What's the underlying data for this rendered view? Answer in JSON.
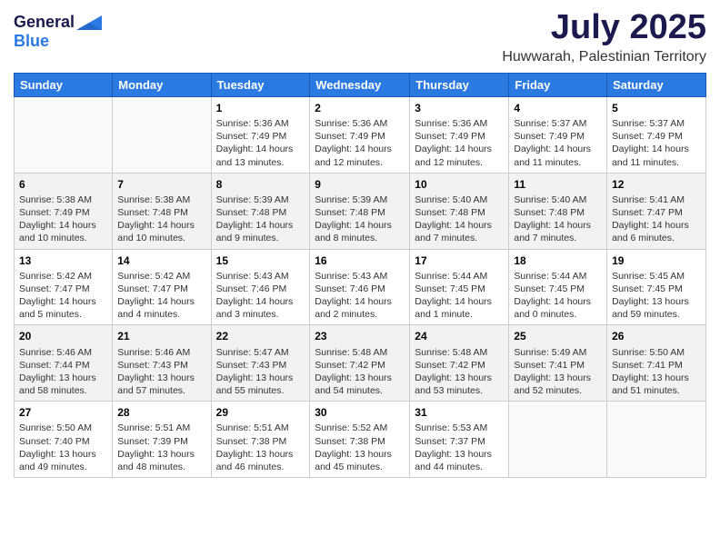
{
  "header": {
    "logo": {
      "general": "General",
      "blue": "Blue"
    },
    "title": "July 2025",
    "location": "Huwwarah, Palestinian Territory"
  },
  "weekdays": [
    "Sunday",
    "Monday",
    "Tuesday",
    "Wednesday",
    "Thursday",
    "Friday",
    "Saturday"
  ],
  "weeks": [
    [
      {
        "day": "",
        "info": ""
      },
      {
        "day": "",
        "info": ""
      },
      {
        "day": "1",
        "info": "Sunrise: 5:36 AM\nSunset: 7:49 PM\nDaylight: 14 hours\nand 13 minutes."
      },
      {
        "day": "2",
        "info": "Sunrise: 5:36 AM\nSunset: 7:49 PM\nDaylight: 14 hours\nand 12 minutes."
      },
      {
        "day": "3",
        "info": "Sunrise: 5:36 AM\nSunset: 7:49 PM\nDaylight: 14 hours\nand 12 minutes."
      },
      {
        "day": "4",
        "info": "Sunrise: 5:37 AM\nSunset: 7:49 PM\nDaylight: 14 hours\nand 11 minutes."
      },
      {
        "day": "5",
        "info": "Sunrise: 5:37 AM\nSunset: 7:49 PM\nDaylight: 14 hours\nand 11 minutes."
      }
    ],
    [
      {
        "day": "6",
        "info": "Sunrise: 5:38 AM\nSunset: 7:49 PM\nDaylight: 14 hours\nand 10 minutes."
      },
      {
        "day": "7",
        "info": "Sunrise: 5:38 AM\nSunset: 7:48 PM\nDaylight: 14 hours\nand 10 minutes."
      },
      {
        "day": "8",
        "info": "Sunrise: 5:39 AM\nSunset: 7:48 PM\nDaylight: 14 hours\nand 9 minutes."
      },
      {
        "day": "9",
        "info": "Sunrise: 5:39 AM\nSunset: 7:48 PM\nDaylight: 14 hours\nand 8 minutes."
      },
      {
        "day": "10",
        "info": "Sunrise: 5:40 AM\nSunset: 7:48 PM\nDaylight: 14 hours\nand 7 minutes."
      },
      {
        "day": "11",
        "info": "Sunrise: 5:40 AM\nSunset: 7:48 PM\nDaylight: 14 hours\nand 7 minutes."
      },
      {
        "day": "12",
        "info": "Sunrise: 5:41 AM\nSunset: 7:47 PM\nDaylight: 14 hours\nand 6 minutes."
      }
    ],
    [
      {
        "day": "13",
        "info": "Sunrise: 5:42 AM\nSunset: 7:47 PM\nDaylight: 14 hours\nand 5 minutes."
      },
      {
        "day": "14",
        "info": "Sunrise: 5:42 AM\nSunset: 7:47 PM\nDaylight: 14 hours\nand 4 minutes."
      },
      {
        "day": "15",
        "info": "Sunrise: 5:43 AM\nSunset: 7:46 PM\nDaylight: 14 hours\nand 3 minutes."
      },
      {
        "day": "16",
        "info": "Sunrise: 5:43 AM\nSunset: 7:46 PM\nDaylight: 14 hours\nand 2 minutes."
      },
      {
        "day": "17",
        "info": "Sunrise: 5:44 AM\nSunset: 7:45 PM\nDaylight: 14 hours\nand 1 minute."
      },
      {
        "day": "18",
        "info": "Sunrise: 5:44 AM\nSunset: 7:45 PM\nDaylight: 14 hours\nand 0 minutes."
      },
      {
        "day": "19",
        "info": "Sunrise: 5:45 AM\nSunset: 7:45 PM\nDaylight: 13 hours\nand 59 minutes."
      }
    ],
    [
      {
        "day": "20",
        "info": "Sunrise: 5:46 AM\nSunset: 7:44 PM\nDaylight: 13 hours\nand 58 minutes."
      },
      {
        "day": "21",
        "info": "Sunrise: 5:46 AM\nSunset: 7:43 PM\nDaylight: 13 hours\nand 57 minutes."
      },
      {
        "day": "22",
        "info": "Sunrise: 5:47 AM\nSunset: 7:43 PM\nDaylight: 13 hours\nand 55 minutes."
      },
      {
        "day": "23",
        "info": "Sunrise: 5:48 AM\nSunset: 7:42 PM\nDaylight: 13 hours\nand 54 minutes."
      },
      {
        "day": "24",
        "info": "Sunrise: 5:48 AM\nSunset: 7:42 PM\nDaylight: 13 hours\nand 53 minutes."
      },
      {
        "day": "25",
        "info": "Sunrise: 5:49 AM\nSunset: 7:41 PM\nDaylight: 13 hours\nand 52 minutes."
      },
      {
        "day": "26",
        "info": "Sunrise: 5:50 AM\nSunset: 7:41 PM\nDaylight: 13 hours\nand 51 minutes."
      }
    ],
    [
      {
        "day": "27",
        "info": "Sunrise: 5:50 AM\nSunset: 7:40 PM\nDaylight: 13 hours\nand 49 minutes."
      },
      {
        "day": "28",
        "info": "Sunrise: 5:51 AM\nSunset: 7:39 PM\nDaylight: 13 hours\nand 48 minutes."
      },
      {
        "day": "29",
        "info": "Sunrise: 5:51 AM\nSunset: 7:38 PM\nDaylight: 13 hours\nand 46 minutes."
      },
      {
        "day": "30",
        "info": "Sunrise: 5:52 AM\nSunset: 7:38 PM\nDaylight: 13 hours\nand 45 minutes."
      },
      {
        "day": "31",
        "info": "Sunrise: 5:53 AM\nSunset: 7:37 PM\nDaylight: 13 hours\nand 44 minutes."
      },
      {
        "day": "",
        "info": ""
      },
      {
        "day": "",
        "info": ""
      }
    ]
  ]
}
